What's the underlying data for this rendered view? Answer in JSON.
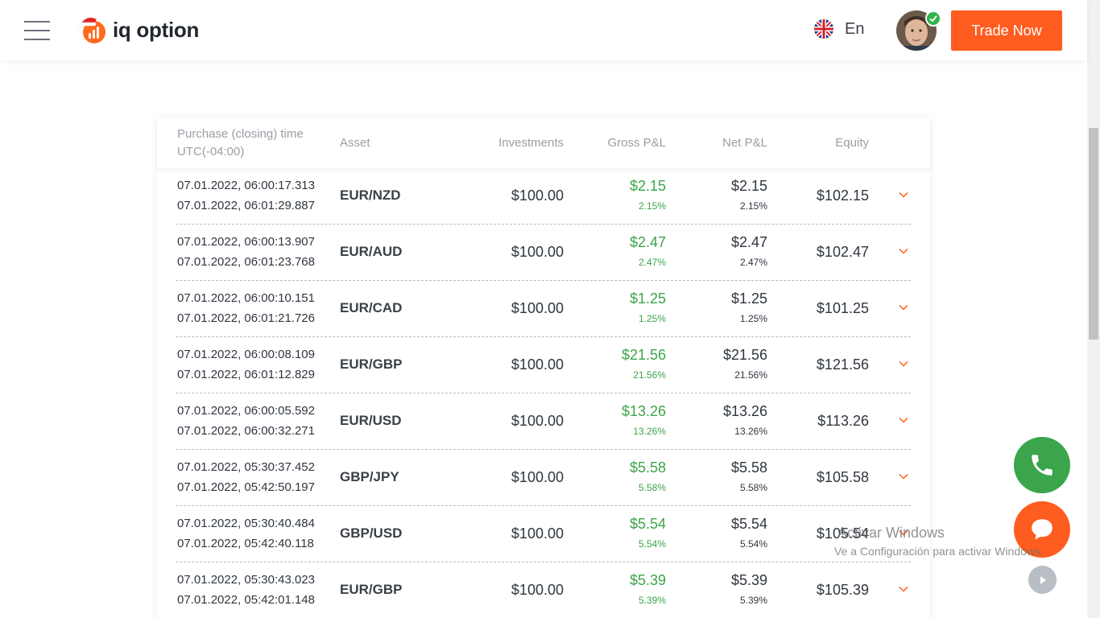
{
  "header": {
    "brand": "iq option",
    "language": "En",
    "trade_button": "Trade Now"
  },
  "table": {
    "columns": {
      "time": "Purchase (closing) time UTC(-04:00)",
      "asset": "Asset",
      "investments": "Investments",
      "gross": "Gross P&L",
      "net": "Net P&L",
      "equity": "Equity"
    },
    "rows": [
      {
        "open": "07.01.2022, 06:00:17.313",
        "close": "07.01.2022, 06:01:29.887",
        "asset": "EUR/NZD",
        "investment": "$100.00",
        "gross": "$2.15",
        "gross_pct": "2.15%",
        "net": "$2.15",
        "net_pct": "2.15%",
        "equity": "$102.15"
      },
      {
        "open": "07.01.2022, 06:00:13.907",
        "close": "07.01.2022, 06:01:23.768",
        "asset": "EUR/AUD",
        "investment": "$100.00",
        "gross": "$2.47",
        "gross_pct": "2.47%",
        "net": "$2.47",
        "net_pct": "2.47%",
        "equity": "$102.47"
      },
      {
        "open": "07.01.2022, 06:00:10.151",
        "close": "07.01.2022, 06:01:21.726",
        "asset": "EUR/CAD",
        "investment": "$100.00",
        "gross": "$1.25",
        "gross_pct": "1.25%",
        "net": "$1.25",
        "net_pct": "1.25%",
        "equity": "$101.25"
      },
      {
        "open": "07.01.2022, 06:00:08.109",
        "close": "07.01.2022, 06:01:12.829",
        "asset": "EUR/GBP",
        "investment": "$100.00",
        "gross": "$21.56",
        "gross_pct": "21.56%",
        "net": "$21.56",
        "net_pct": "21.56%",
        "equity": "$121.56"
      },
      {
        "open": "07.01.2022, 06:00:05.592",
        "close": "07.01.2022, 06:00:32.271",
        "asset": "EUR/USD",
        "investment": "$100.00",
        "gross": "$13.26",
        "gross_pct": "13.26%",
        "net": "$13.26",
        "net_pct": "13.26%",
        "equity": "$113.26"
      },
      {
        "open": "07.01.2022, 05:30:37.452",
        "close": "07.01.2022, 05:42:50.197",
        "asset": "GBP/JPY",
        "investment": "$100.00",
        "gross": "$5.58",
        "gross_pct": "5.58%",
        "net": "$5.58",
        "net_pct": "5.58%",
        "equity": "$105.58"
      },
      {
        "open": "07.01.2022, 05:30:40.484",
        "close": "07.01.2022, 05:42:40.118",
        "asset": "GBP/USD",
        "investment": "$100.00",
        "gross": "$5.54",
        "gross_pct": "5.54%",
        "net": "$5.54",
        "net_pct": "5.54%",
        "equity": "$105.54"
      },
      {
        "open": "07.01.2022, 05:30:43.023",
        "close": "07.01.2022, 05:42:01.148",
        "asset": "EUR/GBP",
        "investment": "$100.00",
        "gross": "$5.39",
        "gross_pct": "5.39%",
        "net": "$5.39",
        "net_pct": "5.39%",
        "equity": "$105.39"
      }
    ]
  },
  "watermark": {
    "title": "Activar Windows",
    "subtitle": "Ve a Configuración para activar Windows."
  },
  "colors": {
    "accent_orange": "#ff5c1f",
    "profit_green": "#3aa54a",
    "text_dark": "#2f3640",
    "text_muted": "#9a9ea6"
  },
  "icons": {
    "menu": "hamburger-menu-icon",
    "language_flag": "uk-flag-icon",
    "verified": "check-badge-icon",
    "row_expand": "chevron-down-icon",
    "phone": "phone-icon",
    "chat": "chat-bubble-icon",
    "play": "play-icon"
  }
}
